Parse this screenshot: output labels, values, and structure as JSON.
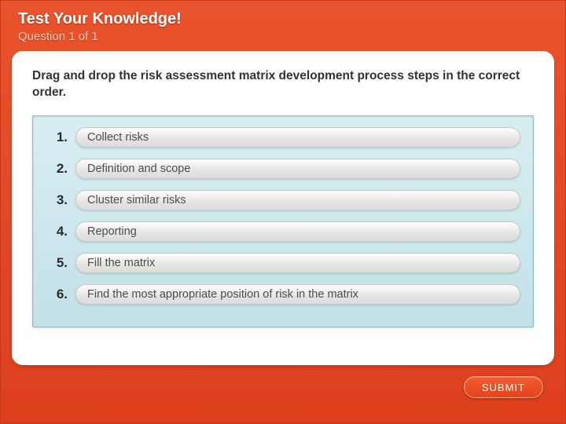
{
  "header": {
    "title": "Test Your Knowledge!",
    "subtitle": "Question 1 of 1"
  },
  "instruction": "Drag and drop the risk assessment matrix development process steps in the correct order.",
  "items": [
    {
      "num": "1.",
      "label": "Collect risks"
    },
    {
      "num": "2.",
      "label": "Definition and scope"
    },
    {
      "num": "3.",
      "label": "Cluster similar risks"
    },
    {
      "num": "4.",
      "label": "Reporting"
    },
    {
      "num": "5.",
      "label": "Fill the matrix"
    },
    {
      "num": "6.",
      "label": "Find the most appropriate position of risk in the matrix"
    }
  ],
  "submit_label": "SUBMIT"
}
